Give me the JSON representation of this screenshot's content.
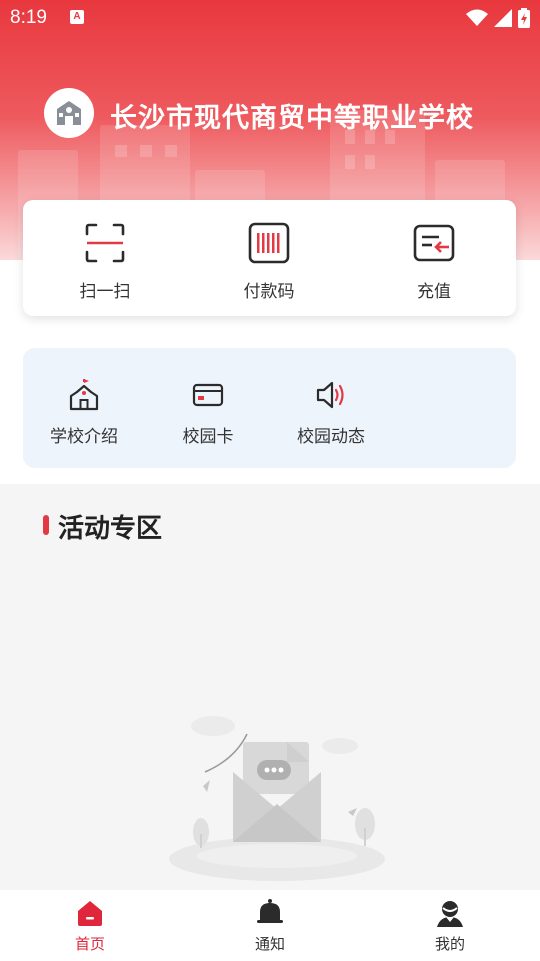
{
  "status_bar": {
    "time": "8:19",
    "notification_letter": "A"
  },
  "header": {
    "school_name": "长沙市现代商贸中等职业学校"
  },
  "actions": [
    {
      "label": "扫一扫",
      "icon": "scan-icon"
    },
    {
      "label": "付款码",
      "icon": "barcode-icon"
    },
    {
      "label": "充值",
      "icon": "recharge-icon"
    }
  ],
  "quick_links": [
    {
      "label": "学校介绍",
      "icon": "school-icon"
    },
    {
      "label": "校园卡",
      "icon": "card-icon"
    },
    {
      "label": "校园动态",
      "icon": "speaker-icon"
    }
  ],
  "activity": {
    "title": "活动专区"
  },
  "bottom_nav": [
    {
      "label": "首页",
      "icon": "home-icon",
      "active": true
    },
    {
      "label": "通知",
      "icon": "bell-icon",
      "active": false
    },
    {
      "label": "我的",
      "icon": "profile-icon",
      "active": false
    }
  ],
  "colors": {
    "brand_red": "#e8383e",
    "active_red": "#e0263a",
    "quick_bg": "#eef4fc",
    "activity_bg": "#f5f5f5"
  }
}
